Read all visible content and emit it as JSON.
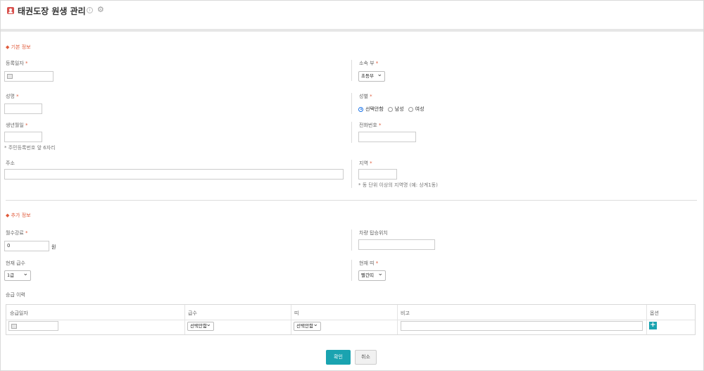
{
  "header": {
    "title": "태권도장 원생 관리"
  },
  "sections": {
    "basic": "◆ 기본 정보",
    "extra": "◆ 추가 정보"
  },
  "required_mark": "*",
  "fields": {
    "reg_date": {
      "label": "등록일자"
    },
    "dept": {
      "label": "소속 부",
      "value": "초등부"
    },
    "name": {
      "label": "성명"
    },
    "gender": {
      "label": "성별",
      "options": [
        "선택안함",
        "남성",
        "여성"
      ],
      "selected": "선택안함"
    },
    "birth": {
      "label": "생년월일",
      "hint": "* 주민등록번호 앞 6자리"
    },
    "phone": {
      "label": "전화번호"
    },
    "address": {
      "label": "주소"
    },
    "region": {
      "label": "지역",
      "hint": "* 동 단위 이상의 지역명 (예: 상계1동)"
    },
    "fee": {
      "label": "월수강료",
      "value": "0",
      "unit": "원"
    },
    "pickup": {
      "label": "차량 탑승위치"
    },
    "grade": {
      "label": "현재 급수",
      "value": "1급"
    },
    "belt": {
      "label": "현재 띠",
      "value": "빨간띠"
    }
  },
  "promotion": {
    "title": "승급 이력",
    "columns": [
      "승급일자",
      "급수",
      "띠",
      "비고",
      "옵션"
    ],
    "row": {
      "grade": "선택안함",
      "belt": "선택안함"
    }
  },
  "buttons": {
    "confirm": "확인",
    "cancel": "취소"
  }
}
